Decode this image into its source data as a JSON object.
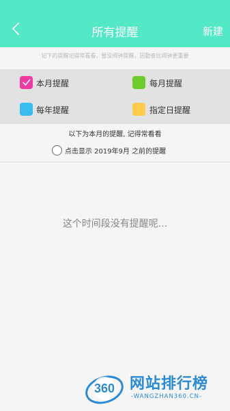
{
  "header": {
    "title": "所有提醒",
    "new_label": "新建",
    "back_icon": "chevron-left-icon",
    "bg_color": "#53e8c6"
  },
  "tip": "记下的提醒记得常看看，暂没闹钟提醒，因勤奋比闹钟更重要",
  "filters": [
    {
      "label": "本月提醒",
      "color": "#ef3aa6",
      "checked": true
    },
    {
      "label": "每月提醒",
      "color": "#6dcb2b",
      "checked": false
    },
    {
      "label": "每年提醒",
      "color": "#38bdf0",
      "checked": false
    },
    {
      "label": "指定日提醒",
      "color": "#ffcb4a",
      "checked": false
    }
  ],
  "info_line": "以下为本月的提醒, 记得常看看",
  "show_previous": {
    "label": "点击显示 2019年9月 之前的提醒",
    "checked": false
  },
  "empty_message": "这个时间段没有提醒呢...",
  "watermark": {
    "logo_text": "360",
    "title": "网站排行榜",
    "url": "-WANGZHAN360.CN-"
  }
}
